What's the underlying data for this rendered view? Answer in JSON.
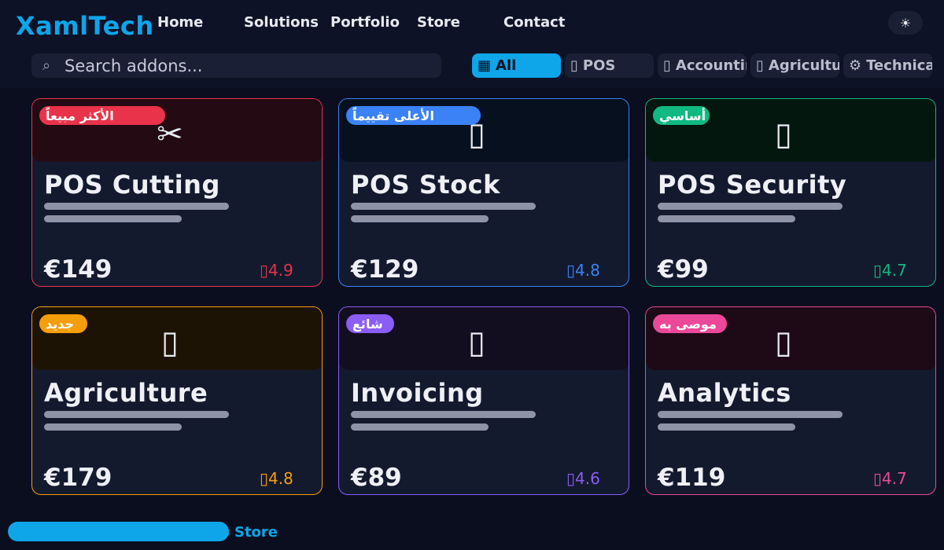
{
  "header": {
    "logo": "XamlTech",
    "nav": [
      "Home",
      "Solutions",
      "Portfolio",
      "Store",
      "Contact"
    ],
    "theme_icon": "☀"
  },
  "search": {
    "icon": "search-icon",
    "icon_glyph": "⌕",
    "placeholder": "Search addons..."
  },
  "filters": [
    {
      "label": "All",
      "icon": "grid-icon",
      "glyph": "▦",
      "active": true
    },
    {
      "label": "POS",
      "icon": "cart-icon",
      "glyph": "▯",
      "active": false
    },
    {
      "label": "Accounting",
      "icon": "ledger-icon",
      "glyph": "▯",
      "active": false
    },
    {
      "label": "Agriculture",
      "icon": "leaf-icon",
      "glyph": "▯",
      "active": false
    },
    {
      "label": "Technical",
      "icon": "gear-icon",
      "glyph": "⚙",
      "active": false
    }
  ],
  "cards": [
    {
      "title": "POS Cutting",
      "badge": "الأكثر مبيعاً",
      "price": "€149",
      "rating": "4.9",
      "rating_icon": "star-icon",
      "icon": "scissors-icon",
      "glyph": "✂",
      "accent": "#e8334a"
    },
    {
      "title": "POS Stock",
      "badge": "الأعلى تقييماً",
      "price": "€129",
      "rating": "4.8",
      "rating_icon": "star-icon",
      "icon": "box-icon",
      "glyph": "▯",
      "accent": "#3b82f6"
    },
    {
      "title": "POS Security",
      "badge": "أساسي",
      "price": "€99",
      "rating": "4.7",
      "rating_icon": "star-icon",
      "icon": "lock-icon",
      "glyph": "▯",
      "accent": "#10b981"
    },
    {
      "title": "Agriculture",
      "badge": "جديد",
      "price": "€179",
      "rating": "4.8",
      "rating_icon": "star-icon",
      "icon": "plant-icon",
      "glyph": "▯",
      "accent": "#f59e0b"
    },
    {
      "title": "Invoicing",
      "badge": "شائع",
      "price": "€89",
      "rating": "4.6",
      "rating_icon": "star-icon",
      "icon": "invoice-icon",
      "glyph": "▯",
      "accent": "#8b5cf6"
    },
    {
      "title": "Analytics",
      "badge": "موصى به",
      "price": "€119",
      "rating": "4.7",
      "rating_icon": "star-icon",
      "icon": "chart-icon",
      "glyph": "▯",
      "accent": "#ec4899"
    }
  ],
  "footer": {
    "link": "s Store"
  },
  "colors": {
    "brand": "#0ea5e9",
    "background": "#0a0e1f"
  }
}
